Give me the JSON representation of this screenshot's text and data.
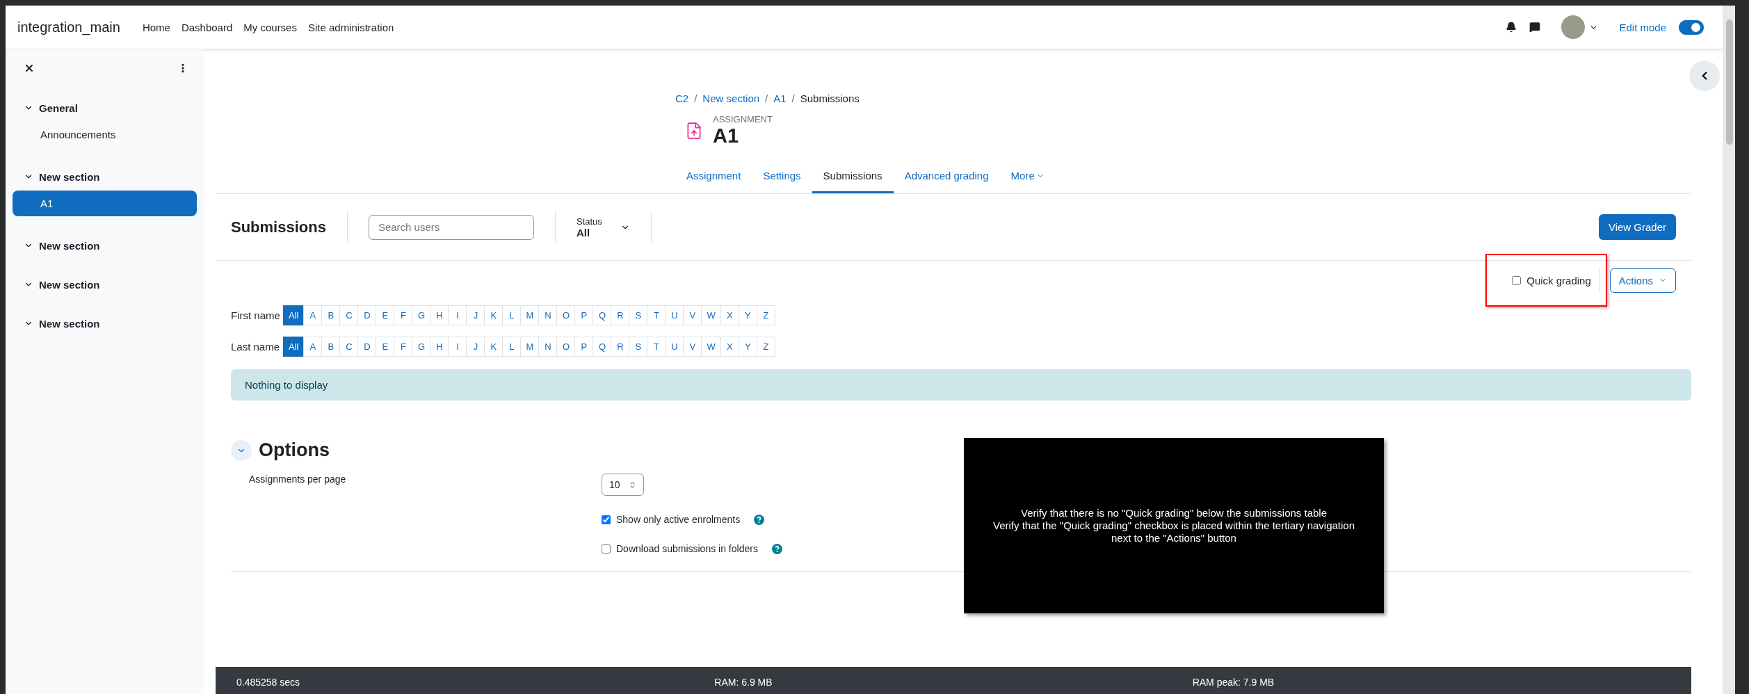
{
  "navbar": {
    "site_name": "integration_main",
    "links": [
      "Home",
      "Dashboard",
      "My courses",
      "Site administration"
    ],
    "edit_mode": {
      "label": "Edit mode",
      "on": true
    }
  },
  "sidebar": {
    "sections": [
      {
        "title": "General",
        "expanded": true,
        "items": [
          {
            "label": "Announcements",
            "selected": false
          }
        ]
      },
      {
        "title": "New section",
        "expanded": true,
        "items": [
          {
            "label": "A1",
            "selected": true
          }
        ]
      },
      {
        "title": "New section",
        "expanded": true
      },
      {
        "title": "New section",
        "expanded": true
      },
      {
        "title": "New section",
        "expanded": true
      }
    ]
  },
  "breadcrumb": {
    "separator": "/",
    "items": [
      {
        "label": "C2",
        "link": true
      },
      {
        "label": "New section",
        "link": true
      },
      {
        "label": "A1",
        "link": true
      },
      {
        "label": "Submissions",
        "link": false
      }
    ]
  },
  "header": {
    "kicker": "ASSIGNMENT",
    "title": "A1"
  },
  "tabs": [
    {
      "label": "Assignment",
      "selected": false,
      "menu": false
    },
    {
      "label": "Settings",
      "selected": false,
      "menu": false
    },
    {
      "label": "Submissions",
      "selected": true,
      "menu": false
    },
    {
      "label": "Advanced grading",
      "selected": false,
      "menu": false
    },
    {
      "label": "More",
      "selected": false,
      "menu": true
    }
  ],
  "toolbar": {
    "title": "Submissions",
    "search": {
      "placeholder": "Search users"
    },
    "status": {
      "label": "Status",
      "value": "All"
    },
    "view_grader": "View Grader"
  },
  "quick_grading": {
    "label": "Quick grading",
    "checked": false
  },
  "actions": "Actions",
  "initials_bars": [
    {
      "label": "First name",
      "letters": [
        {
          "label": "All",
          "selected": true
        },
        {
          "label": "A",
          "selected": false
        },
        {
          "label": "B",
          "selected": false
        },
        {
          "label": "C",
          "selected": false
        },
        {
          "label": "D",
          "selected": false
        },
        {
          "label": "E",
          "selected": false
        },
        {
          "label": "F",
          "selected": false
        },
        {
          "label": "G",
          "selected": false
        },
        {
          "label": "H",
          "selected": false
        },
        {
          "label": "I",
          "selected": false
        },
        {
          "label": "J",
          "selected": false
        },
        {
          "label": "K",
          "selected": false
        },
        {
          "label": "L",
          "selected": false
        },
        {
          "label": "M",
          "selected": false
        },
        {
          "label": "N",
          "selected": false
        },
        {
          "label": "O",
          "selected": false
        },
        {
          "label": "P",
          "selected": false
        },
        {
          "label": "Q",
          "selected": false
        },
        {
          "label": "R",
          "selected": false
        },
        {
          "label": "S",
          "selected": false
        },
        {
          "label": "T",
          "selected": false
        },
        {
          "label": "U",
          "selected": false
        },
        {
          "label": "V",
          "selected": false
        },
        {
          "label": "W",
          "selected": false
        },
        {
          "label": "X",
          "selected": false
        },
        {
          "label": "Y",
          "selected": false
        },
        {
          "label": "Z",
          "selected": false
        }
      ]
    },
    {
      "label": "Last name",
      "letters": [
        {
          "label": "All",
          "selected": true
        },
        {
          "label": "A",
          "selected": false
        },
        {
          "label": "B",
          "selected": false
        },
        {
          "label": "C",
          "selected": false
        },
        {
          "label": "D",
          "selected": false
        },
        {
          "label": "E",
          "selected": false
        },
        {
          "label": "F",
          "selected": false
        },
        {
          "label": "G",
          "selected": false
        },
        {
          "label": "H",
          "selected": false
        },
        {
          "label": "I",
          "selected": false
        },
        {
          "label": "J",
          "selected": false
        },
        {
          "label": "K",
          "selected": false
        },
        {
          "label": "L",
          "selected": false
        },
        {
          "label": "M",
          "selected": false
        },
        {
          "label": "N",
          "selected": false
        },
        {
          "label": "O",
          "selected": false
        },
        {
          "label": "P",
          "selected": false
        },
        {
          "label": "Q",
          "selected": false
        },
        {
          "label": "R",
          "selected": false
        },
        {
          "label": "S",
          "selected": false
        },
        {
          "label": "T",
          "selected": false
        },
        {
          "label": "U",
          "selected": false
        },
        {
          "label": "V",
          "selected": false
        },
        {
          "label": "W",
          "selected": false
        },
        {
          "label": "X",
          "selected": false
        },
        {
          "label": "Y",
          "selected": false
        },
        {
          "label": "Z",
          "selected": false
        }
      ]
    }
  ],
  "notice": "Nothing to display",
  "options": {
    "title": "Options",
    "expanded": true,
    "per_page": {
      "label": "Assignments per page",
      "value": "10"
    },
    "checkboxes": [
      {
        "label": "Show only active enrolments",
        "checked": true
      },
      {
        "label": "Download submissions in folders",
        "checked": false
      }
    ]
  },
  "overlay": {
    "lines": [
      "Verify that there is no \"Quick grading\" below the submissions table",
      "Verify that the \"Quick grading\" checkbox is placed within the tertiary navigation",
      "next to the \"Actions\" button"
    ]
  },
  "footer": [
    "0.485258 secs",
    "RAM: 6.9 MB",
    "RAM peak: 7.9 MB"
  ]
}
